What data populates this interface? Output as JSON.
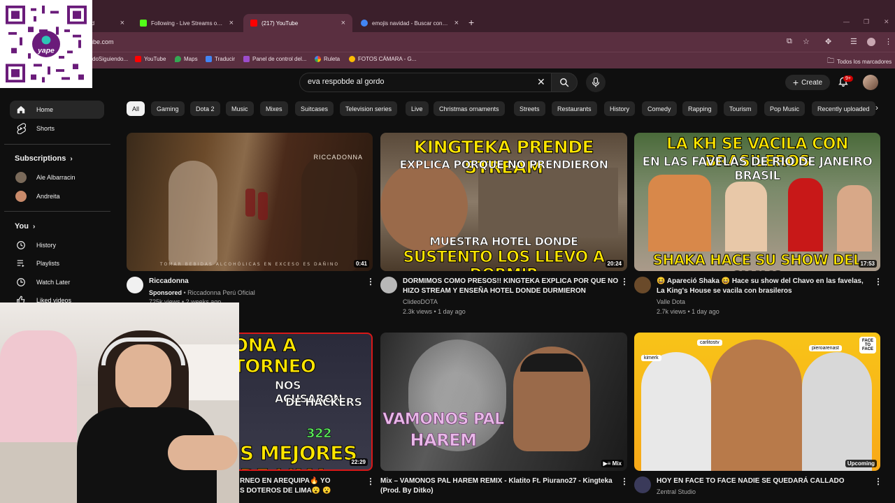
{
  "browser": {
    "tabs": [
      {
        "title": "rd",
        "favicon_color": "#e8e8e8"
      },
      {
        "title": "Following - Live Streams on Kick",
        "favicon_color": "#53fc18"
      },
      {
        "title": "(217) YouTube",
        "favicon_color": "#ff0000"
      },
      {
        "title": "emojis navidad - Buscar con Google",
        "favicon_color": "#4285f4"
      }
    ],
    "url": "ube.com",
    "bookmarks": [
      {
        "label": "doSiguiendo...",
        "color": "#888888"
      },
      {
        "label": "YouTube",
        "color": "#ff0000"
      },
      {
        "label": "Maps",
        "color": "#34a853"
      },
      {
        "label": "Traducir",
        "color": "#4285f4"
      },
      {
        "label": "Panel de control del...",
        "color": "#9c4dcc"
      },
      {
        "label": "Ruleta",
        "color": "#f4b400"
      },
      {
        "label": "FOTOS CÁMARA - G...",
        "color": "#fbbc04"
      }
    ],
    "all_bookmarks": "Todos los marcadores"
  },
  "overlay": {
    "qr_brand": "yape"
  },
  "header": {
    "search_query": "eva respobde al gordo",
    "create_label": "Create",
    "notifications": "9+"
  },
  "sidebar": {
    "home": "Home",
    "shorts": "Shorts",
    "subscriptions_heading": "Subscriptions",
    "subscriptions": [
      {
        "name": "Ale Albarracin",
        "color": "#7a6a5a"
      },
      {
        "name": "Andreita",
        "color": "#c98a6a"
      }
    ],
    "you_heading": "You",
    "you_items": [
      "History",
      "Playlists",
      "Watch Later",
      "Liked videos"
    ]
  },
  "chips": [
    "All",
    "Gaming",
    "Dota 2",
    "Music",
    "Mixes",
    "Suitcases",
    "Television series",
    "Live",
    "Christmas ornaments",
    "Streets",
    "Restaurants",
    "History",
    "Comedy",
    "Rapping",
    "Tourism",
    "Pop Music",
    "Recently uploaded"
  ],
  "videos": [
    {
      "title": "Riccadonna",
      "sponsored": "Sponsored",
      "channel": "Riccadonna Perú Oficial",
      "meta": "725k views • 2 weeks ago",
      "duration": "0:41",
      "thumb_text": "TOMAR BEBIDAS ALCOHÓLICAS EN EXCESO ES DAÑINO",
      "brand": "RICCADONNA"
    },
    {
      "title_line1": "DORMIMOS COMO PRESOS!! KINGTEKA EXPLICA POR QUE NO",
      "title_line2": "HIZO STREAM  Y ENSEÑA HOTEL DONDE DURMIERON",
      "channel": "ClideoDOTA",
      "meta": "2.3k views • 1 day ago",
      "duration": "20:24",
      "thumb_top1": "KINGTEKA PRENDE STREAM",
      "thumb_top2": "EXPLICA PORQUE NO PRENDIERON",
      "thumb_bot1": "MUESTRA HOTEL DONDE",
      "thumb_bot2": "SUSTENTO LOS LLEVO A DORMIR"
    },
    {
      "title_line1": "😆 Apareció Shaka 😆 Hace su show del Chavo en las favelas,",
      "title_line2": "La King's House se vacila con brasileros",
      "channel": "Valle Dota",
      "meta": "2.7k views • 1 day ago",
      "duration": "17:53",
      "thumb_top1": "LA KH SE VACILA CON BRASILEROS",
      "thumb_top2": "EN LAS FAVELAS DE RIO DE JANEIRO BRASIL",
      "thumb_bot1": "SHAKA HACE SU SHOW DEL CHAVO"
    },
    {
      "title_line1": "RNEO EN AREQUIPA🔥 YO",
      "title_line2": "S DOTEROS DE LIMA😮 😮",
      "duration": "22:29",
      "thumb_top1": "ONA A TORNEO",
      "thumb_mid1": "NOS ACUSARON",
      "thumb_mid2": "DE HACKERS",
      "thumb_num": "322",
      "thumb_bot1": "S MEJORES DE LIMA"
    },
    {
      "title_line1": "Mix – VAMONOS PAL HAREM REMIX - Klatito Ft. Piurano27 - Kingteka",
      "title_line2": "(Prod. By Ditko)",
      "duration": "Mix",
      "thumb_text1": "VAMONOS PAL",
      "thumb_text2": "HAREM"
    },
    {
      "title_line1": "HOY EN FACE TO FACE NADIE SE QUEDARÁ CALLADO",
      "channel": "Zentral Studio",
      "duration": "Upcoming",
      "tag1": "carlitostv",
      "tag2": "kimerk",
      "tag3": "pieroarenast",
      "badge": "FACE TO FACE"
    }
  ]
}
